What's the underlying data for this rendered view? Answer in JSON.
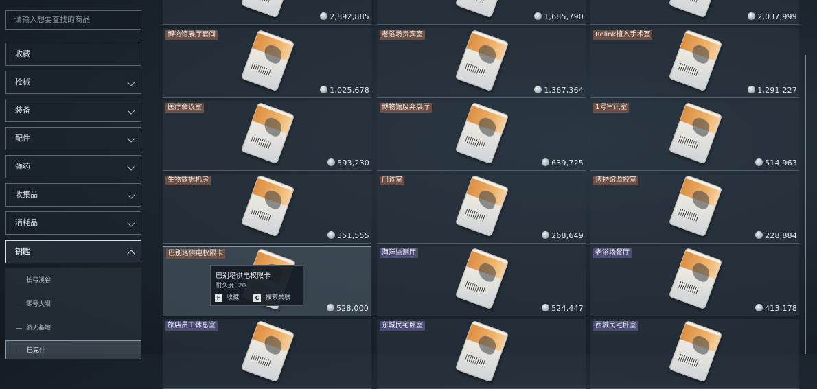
{
  "search": {
    "placeholder": "请输入想要查找的商品"
  },
  "sidebar": {
    "categories": [
      {
        "label": "收藏"
      },
      {
        "label": "枪械"
      },
      {
        "label": "装备"
      },
      {
        "label": "配件"
      },
      {
        "label": "弹药"
      },
      {
        "label": "收集品"
      },
      {
        "label": "消耗品"
      },
      {
        "label": "钥匙"
      }
    ],
    "subitems": [
      {
        "label": "长弓溪谷"
      },
      {
        "label": "零号大坝"
      },
      {
        "label": "航天基地"
      },
      {
        "label": "巴克什"
      }
    ]
  },
  "grid": {
    "items": [
      {
        "name": "",
        "price": "2,892,885"
      },
      {
        "name": "",
        "price": "1,685,790"
      },
      {
        "name": "",
        "price": "2,037,999"
      },
      {
        "name": "博物馆展厅套间",
        "price": "1,025,678"
      },
      {
        "name": "老浴场贵宾室",
        "price": "1,367,364"
      },
      {
        "name": "Relink植入手术室",
        "price": "1,291,227"
      },
      {
        "name": "医疗会议室",
        "price": "593,230"
      },
      {
        "name": "博物馆废弃展厅",
        "price": "639,725"
      },
      {
        "name": "1号审讯室",
        "price": "514,963"
      },
      {
        "name": "生物数据机房",
        "price": "351,555"
      },
      {
        "name": "门诊室",
        "price": "268,649"
      },
      {
        "name": "博物馆监控室",
        "price": "228,884"
      },
      {
        "name": "巴别塔供电权限卡",
        "price": "528,000"
      },
      {
        "name": "海洋监测厅",
        "price": "524,447"
      },
      {
        "name": "老浴场餐厅",
        "price": "413,178"
      },
      {
        "name": "旅店员工休息室",
        "price": ""
      },
      {
        "name": "东城民宅卧室",
        "price": ""
      },
      {
        "name": "西城民宅卧室",
        "price": ""
      }
    ],
    "tag_colors": {
      "brown": "#7a5442",
      "purple": "#565282"
    }
  },
  "tooltip": {
    "name": "巴别塔供电权限卡",
    "durability": "耐久度: 20",
    "key_f": "F",
    "action_f": "收藏",
    "key_c": "C",
    "action_c": "搜索关联"
  }
}
